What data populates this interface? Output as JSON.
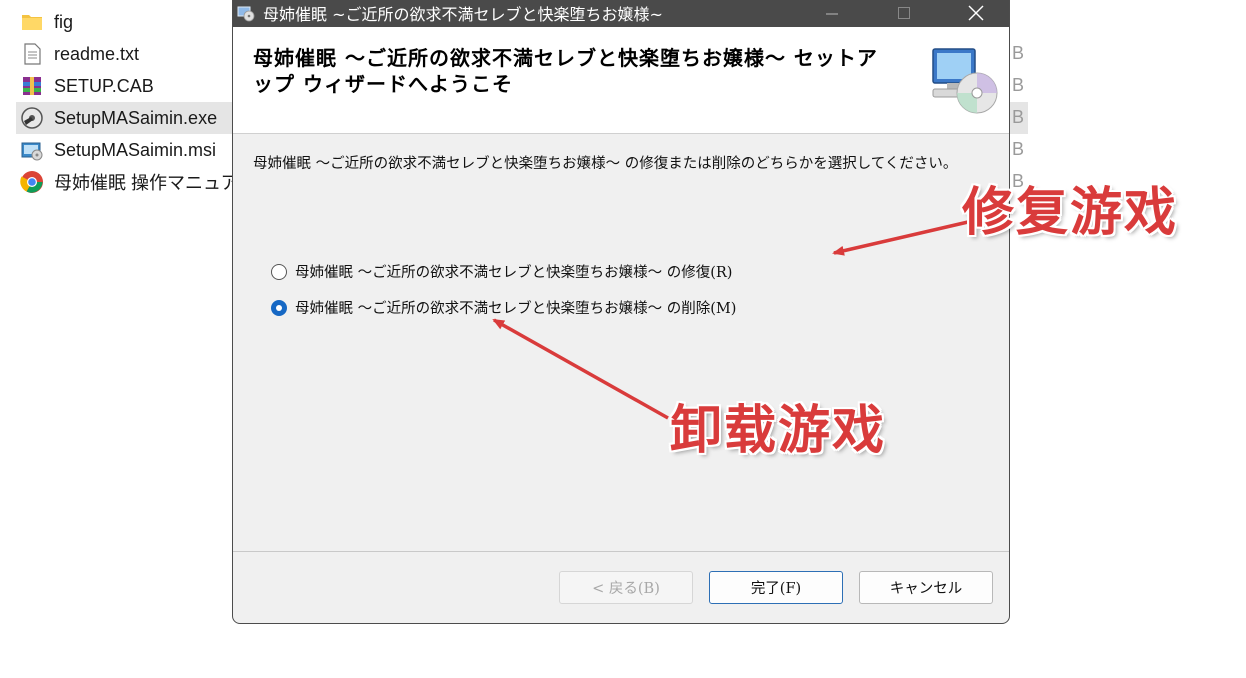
{
  "explorer": {
    "files": [
      {
        "name": "fig",
        "icon": "folder-icon",
        "size_fragment": ""
      },
      {
        "name": "readme.txt",
        "icon": "text-file-icon",
        "size_fragment": "B"
      },
      {
        "name": "SETUP.CAB",
        "icon": "archive-icon",
        "size_fragment": "B"
      },
      {
        "name": "SetupMASaimin.exe",
        "icon": "setup-exe-icon",
        "size_fragment": "B",
        "selected": true
      },
      {
        "name": "SetupMASaimin.msi",
        "icon": "msi-package-icon",
        "size_fragment": "B"
      },
      {
        "name": "母姉催眠 操作マニュア",
        "icon": "chrome-icon",
        "size_fragment": "B"
      }
    ]
  },
  "dialog": {
    "title": "母姉催眠 ~ご近所の欲求不満セレブと快楽堕ちお嬢様~",
    "header_title": "母姉催眠 ～ご近所の欲求不満セレブと快楽堕ちお嬢様～ セットアップ ウィザードへようこそ",
    "intro": "母姉催眠 ～ご近所の欲求不満セレブと快楽堕ちお嬢様～ の修復または削除のどちらかを選択してください。",
    "options": [
      {
        "label": "母姉催眠 ～ご近所の欲求不満セレブと快楽堕ちお嬢様～ の修復(R)",
        "checked": false
      },
      {
        "label": "母姉催眠 ～ご近所の欲求不満セレブと快楽堕ちお嬢様～ の削除(M)",
        "checked": true
      }
    ],
    "buttons": {
      "back": "< 戻る(B)",
      "finish": "完了(F)",
      "cancel": "キャンセル"
    }
  },
  "annotations": {
    "repair": "修复游戏",
    "uninstall": "卸载游戏",
    "color": "#d93b3b"
  },
  "colors": {
    "titlebar": "#4a4a4a",
    "radio_checked": "#1668c4",
    "primary_button_border": "#2d6fb5"
  }
}
